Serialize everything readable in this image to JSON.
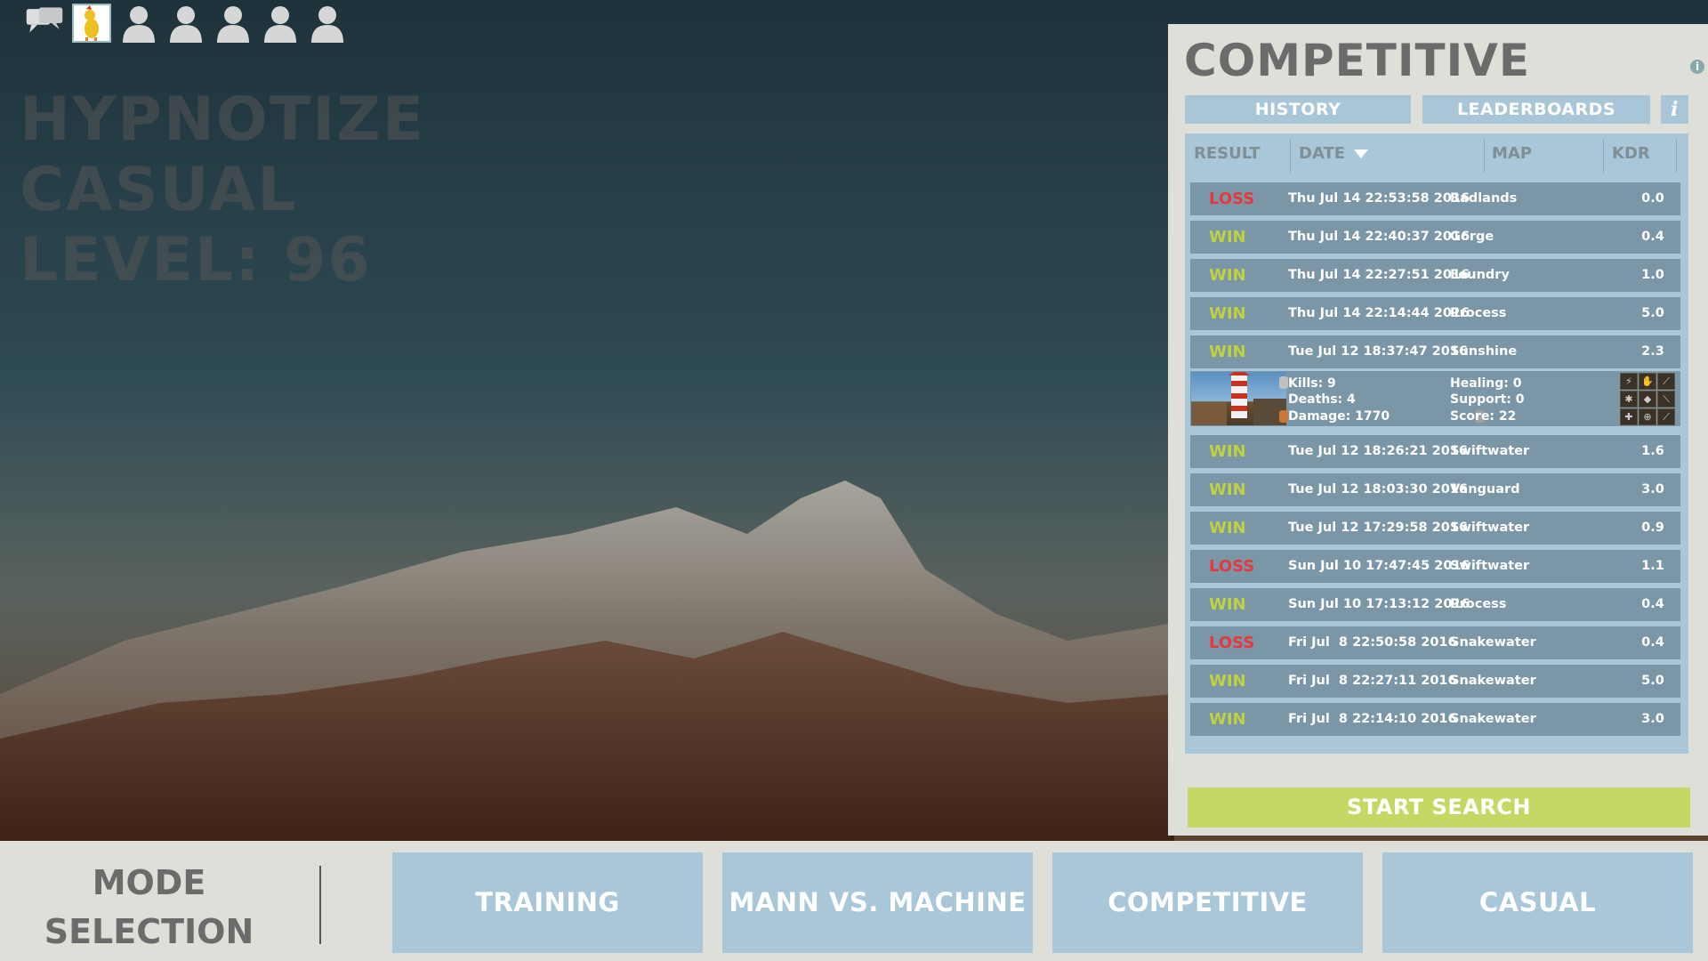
{
  "party": {
    "chat_icon": "chat-bubbles-icon",
    "avatar_icon": "player-avatar",
    "slot_icon": "empty-party-slot-icon",
    "slots": 5
  },
  "player": {
    "name": "HYPNOTIZE",
    "mode": "CASUAL",
    "level": "LEVEL: 96"
  },
  "panel": {
    "title": "COMPETITIVE",
    "tabs": {
      "history": "HISTORY",
      "leaderboards": "LEADERBOARDS",
      "info": "i"
    },
    "table": {
      "headers": {
        "result": "RESULT",
        "date": "DATE",
        "map": "MAP",
        "kdr": "KDR"
      },
      "sort_icon": "sort-descending-icon",
      "rows": [
        {
          "result": "LOSS",
          "date": "Thu Jul 14 22:53:58 2016",
          "map": "Badlands",
          "kdr": "0.0"
        },
        {
          "result": "WIN",
          "date": "Thu Jul 14 22:40:37 2016",
          "map": "Gorge",
          "kdr": "0.4"
        },
        {
          "result": "WIN",
          "date": "Thu Jul 14 22:27:51 2016",
          "map": "Foundry",
          "kdr": "1.0"
        },
        {
          "result": "WIN",
          "date": "Thu Jul 14 22:14:44 2016",
          "map": "Process",
          "kdr": "5.0"
        },
        {
          "result": "WIN",
          "date": "Tue Jul 12 18:37:47 2016",
          "map": "Sunshine",
          "kdr": "2.3"
        },
        {
          "result": "WIN",
          "date": "Tue Jul 12 18:26:21 2016",
          "map": "Swiftwater",
          "kdr": "1.6"
        },
        {
          "result": "WIN",
          "date": "Tue Jul 12 18:03:30 2016",
          "map": "Vanguard",
          "kdr": "3.0"
        },
        {
          "result": "WIN",
          "date": "Tue Jul 12 17:29:58 2016",
          "map": "Swiftwater",
          "kdr": "0.9"
        },
        {
          "result": "LOSS",
          "date": "Sun Jul 10 17:47:45 2016",
          "map": "Swiftwater",
          "kdr": "1.1"
        },
        {
          "result": "WIN",
          "date": "Sun Jul 10 17:13:12 2016",
          "map": "Process",
          "kdr": "0.4"
        },
        {
          "result": "LOSS",
          "date": "Fri Jul  8 22:50:58 2016",
          "map": "Snakewater",
          "kdr": "0.4"
        },
        {
          "result": "WIN",
          "date": "Fri Jul  8 22:27:11 2016",
          "map": "Snakewater",
          "kdr": "5.0"
        },
        {
          "result": "WIN",
          "date": "Fri Jul  8 22:14:10 2016",
          "map": "Snakewater",
          "kdr": "3.0"
        }
      ],
      "expanded": {
        "kills": "Kills: 9",
        "deaths": "Deaths: 4",
        "damage": "Damage: 1770",
        "healing": "Healing: 0",
        "support": "Support: 0",
        "score": "Score: 22"
      }
    },
    "start_search": "START SEARCH"
  },
  "bottom": {
    "mode_label_line1": "MODE",
    "mode_label_line2": "SELECTION",
    "modes": [
      "TRAINING",
      "MANN VS. MACHINE",
      "COMPETITIVE",
      "CASUAL"
    ]
  },
  "colors": {
    "win": "#c1d23f",
    "loss": "#e7373d",
    "panel_bg": "#dedfd9",
    "tile": "#a9c7d9",
    "row": "#7b96a6",
    "start": "#c4d964"
  }
}
